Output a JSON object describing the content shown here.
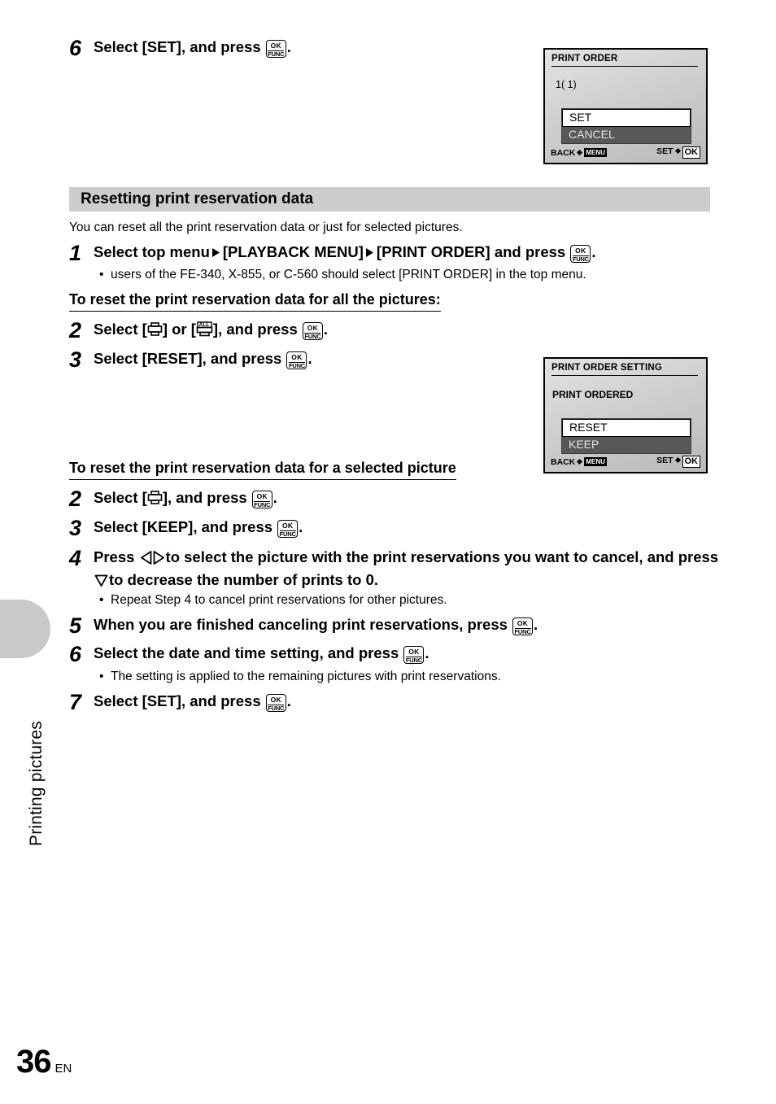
{
  "sidebar": {
    "chapter_label": "Printing pictures"
  },
  "footer": {
    "page_number": "36",
    "language": "EN"
  },
  "top_step": {
    "number": "6",
    "text_before": "Select [SET], and press",
    "text_after": "."
  },
  "section": {
    "heading": "Resetting print reservation data",
    "intro": "You can reset all the print reservation data or just for selected pictures."
  },
  "step1": {
    "number": "1",
    "part1": "Select top menu",
    "part2": "[PLAYBACK MENU]",
    "part3": "[PRINT ORDER] and press",
    "part4": ".",
    "bullet": "users of the FE-340, X-855, or C-560 should select [PRINT ORDER] in the top menu."
  },
  "subhead_all": "To reset the print reservation data for all the pictures:",
  "step2a": {
    "number": "2",
    "part1": "Select [",
    "part2": "] or [",
    "part3": "], and press",
    "part4": "."
  },
  "step3a": {
    "number": "3",
    "part1": "Select [RESET], and press",
    "part2": "."
  },
  "subhead_selected": "To reset the print reservation data for a selected picture",
  "step2b": {
    "number": "2",
    "part1": "Select [",
    "part2": "], and press",
    "part3": "."
  },
  "step3b": {
    "number": "3",
    "part1": "Select [KEEP], and press",
    "part2": "."
  },
  "step4": {
    "number": "4",
    "part1": "Press",
    "part2": "to select the picture with the print reservations you want to",
    "part3": "cancel, and press",
    "part4": "to decrease the number of prints to 0.",
    "bullet": "Repeat Step 4 to cancel print reservations for other pictures."
  },
  "step5": {
    "number": "5",
    "part1": "When you are finished canceling print reservations, press",
    "part2": "."
  },
  "step6": {
    "number": "6",
    "part1": "Select the date and time setting, and press",
    "part2": ".",
    "bullet": "The setting is applied to the remaining pictures with print reservations."
  },
  "step7": {
    "number": "7",
    "part1": "Select [SET], and press",
    "part2": "."
  },
  "lcd1": {
    "title": "PRINT ORDER",
    "count": "1(  1)",
    "options": [
      {
        "label": "SET",
        "selected": true
      },
      {
        "label": "CANCEL",
        "selected": false
      }
    ],
    "footer_left": "BACK",
    "footer_left_key": "MENU",
    "footer_right": "SET",
    "footer_right_key": "OK"
  },
  "lcd2": {
    "title": "PRINT ORDER SETTING",
    "subtitle": "PRINT ORDERED",
    "options": [
      {
        "label": "RESET",
        "selected": true
      },
      {
        "label": "KEEP",
        "selected": false
      }
    ],
    "footer_left": "BACK",
    "footer_left_key": "MENU",
    "footer_right": "SET",
    "footer_right_key": "OK"
  },
  "icons": {
    "ok_line1": "OK",
    "ok_line2": "FUNC",
    "printer": "printer-icon",
    "printer_all": "printer-all-icon",
    "left_right": "left-right-arrow-icon",
    "down": "down-arrow-icon"
  },
  "colors": {
    "band": "#cdcdcd",
    "tab": "#c9c9c9",
    "lcd_menu_bg": "#585858"
  }
}
